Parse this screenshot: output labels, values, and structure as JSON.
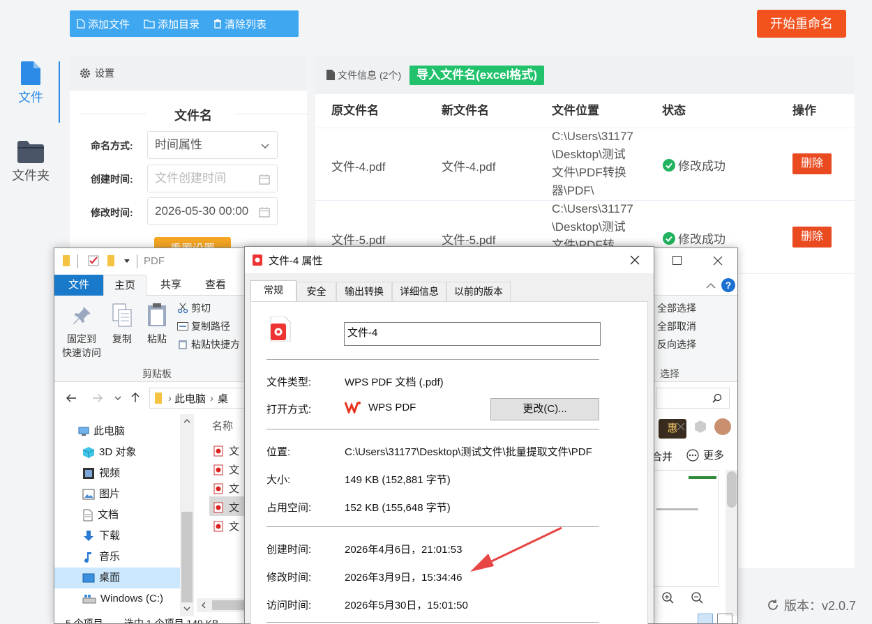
{
  "app": {
    "sidebar": [
      {
        "label": "文件",
        "icon": "file-icon",
        "active": true
      },
      {
        "label": "文件夹",
        "icon": "folder-icon",
        "active": false
      }
    ],
    "toolbar": {
      "add_file": "添加文件",
      "add_dir": "添加目录",
      "clear_list": "清除列表",
      "start": "开始重命名"
    },
    "settings": {
      "header": "设置",
      "section_title": "文件名",
      "naming_label": "命名方式:",
      "naming_value": "时间属性",
      "created_label": "创建时间:",
      "created_placeholder": "文件创建时间",
      "modified_label": "修改时间:",
      "modified_value": "2026-05-30 00:00",
      "reset": "重置设置"
    },
    "files": {
      "header": "文件信息",
      "count": "(2个)",
      "import_btn": "导入文件名(excel格式)",
      "columns": [
        "原文件名",
        "新文件名",
        "文件位置",
        "状态",
        "操作"
      ],
      "rows": [
        {
          "orig": "文件-4.pdf",
          "new": "文件-4.pdf",
          "path": "C:\\Users\\31177\\Desktop\\测试文件\\PDF转换器\\PDF\\",
          "status": "修改成功",
          "action": "删除"
        },
        {
          "orig": "文件-5.pdf",
          "new": "文件-5.pdf",
          "path": "C:\\Users\\31177\\Desktop\\测试文件\\PDF转",
          "status": "修改成功",
          "action": "删除"
        }
      ]
    },
    "version": "版本：v2.0.7"
  },
  "explorer": {
    "title": "PDF",
    "tabs": [
      "文件",
      "主页",
      "共享",
      "查看"
    ],
    "ribbon": {
      "pin": "固定到\n快速访问",
      "copy": "复制",
      "paste": "粘贴",
      "cut": "剪切",
      "copy_path": "复制路径",
      "paste_shortcut": "粘贴快捷方",
      "clipboard_group": "剪贴板",
      "select_all": "全部选择",
      "select_none": "全部取消",
      "invert_select": "反向选择",
      "select_group": "选择"
    },
    "address": [
      "此电脑",
      "桌"
    ],
    "tree": [
      "此电脑",
      "3D 对象",
      "视频",
      "图片",
      "文档",
      "下载",
      "音乐",
      "桌面",
      "Windows (C:)"
    ],
    "list_header": "名称",
    "list_items": [
      "文",
      "文",
      "文",
      "文",
      "文"
    ],
    "right_toolbar": {
      "hui": "惠",
      "merge": "合并",
      "more": "更多"
    },
    "status": {
      "items": "5 个项目",
      "selected": "选中 1 个项目 149 KB"
    }
  },
  "dialog": {
    "title": "文件-4 属性",
    "tabs": [
      "常规",
      "安全",
      "输出转换",
      "详细信息",
      "以前的版本"
    ],
    "name": "文件-4",
    "rows": {
      "type_label": "文件类型:",
      "type_value": "WPS PDF 文档 (.pdf)",
      "open_label": "打开方式:",
      "open_value": "WPS PDF",
      "change_btn": "更改(C)...",
      "location_label": "位置:",
      "location_value": "C:\\Users\\31177\\Desktop\\测试文件\\批量提取文件\\PDF",
      "size_label": "大小:",
      "size_value": "149 KB (152,881 字节)",
      "disk_label": "占用空间:",
      "disk_value": "152 KB (155,648 字节)",
      "created_label": "创建时间:",
      "created_value": "2026年4月6日，21:01:53",
      "modified_label": "修改时间:",
      "modified_value": "2026年3月9日，15:34:46",
      "accessed_label": "访问时间:",
      "accessed_value": "2026年5月30日，15:01:50"
    }
  },
  "colors": {
    "accent_blue": "#2b8be6",
    "toolbar_blue": "#3ea7f0",
    "start_red": "#f2521d",
    "import_green": "#21c26b",
    "delete_red": "#ea4a1f",
    "annotation_arrow": "#e84545"
  }
}
